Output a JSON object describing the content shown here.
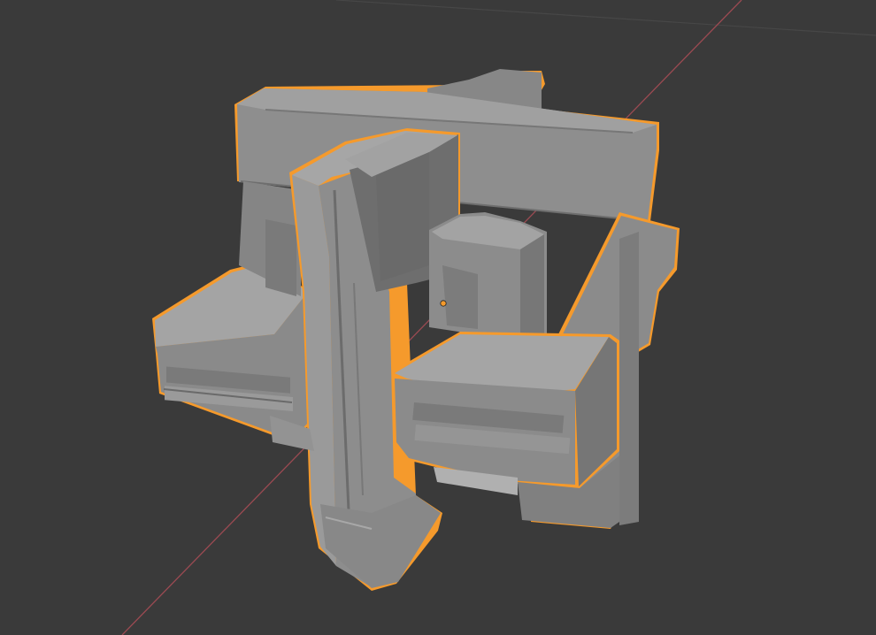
{
  "viewport": {
    "background_color": "#3a3a3a",
    "x_axis_color": "#9b4a52",
    "y_axis_color": "#4f4f4f",
    "selection_outline_color": "#f59a2c",
    "origin_dot_color": "#f59a2c",
    "mesh_base_color": "#8f8f8f",
    "mesh_light_color": "#a3a3a3",
    "mesh_dark_color": "#6a6a6a",
    "selected_object": "greeble-cube-mesh"
  }
}
